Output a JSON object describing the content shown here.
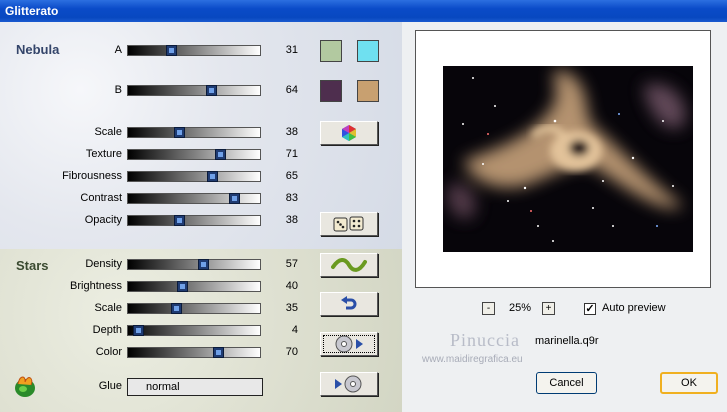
{
  "window": {
    "title": "Glitterato"
  },
  "nebula": {
    "section_label": "Nebula",
    "params": [
      {
        "label": "A",
        "value": "31",
        "level": 0.31
      },
      {
        "label": "B",
        "value": "64",
        "level": 0.64
      },
      {
        "label": "Scale",
        "value": "38",
        "level": 0.38
      },
      {
        "label": "Texture",
        "value": "71",
        "level": 0.71
      },
      {
        "label": "Fibrousness",
        "value": "65",
        "level": 0.65
      },
      {
        "label": "Contrast",
        "value": "83",
        "level": 0.83
      },
      {
        "label": "Opacity",
        "value": "38",
        "level": 0.38
      }
    ],
    "colors": {
      "a1": "#b2c9a0",
      "a2": "#6fe0f0",
      "b1": "#4e2e4e",
      "b2": "#c8a070"
    }
  },
  "stars": {
    "section_label": "Stars",
    "params": [
      {
        "label": "Density",
        "value": "57",
        "level": 0.57
      },
      {
        "label": "Brightness",
        "value": "40",
        "level": 0.4
      },
      {
        "label": "Scale",
        "value": "35",
        "level": 0.35
      },
      {
        "label": "Depth",
        "value": "4",
        "level": 0.04
      },
      {
        "label": "Color",
        "value": "70",
        "level": 0.7
      }
    ],
    "glue_label": "Glue",
    "glue_value": "normal"
  },
  "preview": {
    "zoom_minus": "-",
    "zoom_level": "25%",
    "zoom_plus": "+",
    "auto_preview_label": "Auto preview",
    "auto_preview_checked": true,
    "watermark_name": "Pinuccia",
    "watermark_url": "www.maidiregrafica.eu",
    "filename": "marinella.q9r"
  },
  "buttons": {
    "cancel": "Cancel",
    "ok": "OK"
  }
}
